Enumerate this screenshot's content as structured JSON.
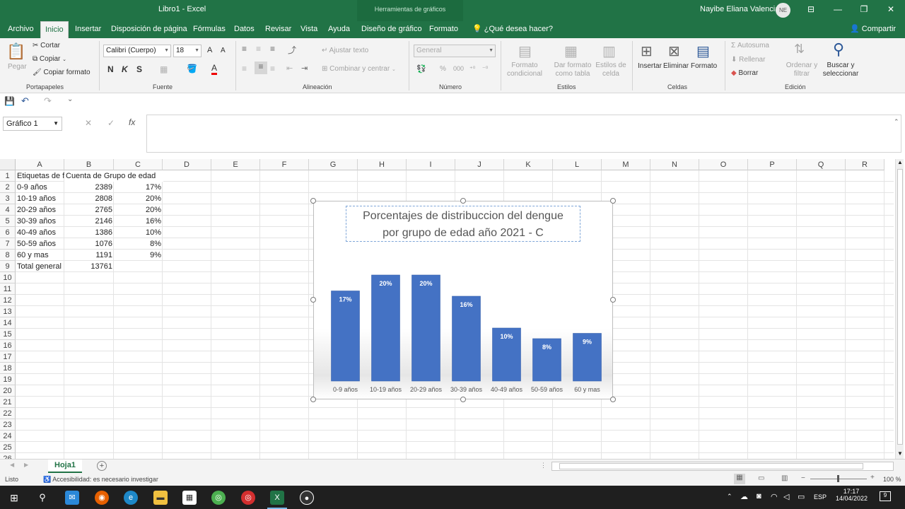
{
  "window": {
    "title": "Libro1  -  Excel",
    "contextual_tab": "Herramientas de gráficos",
    "user_name": "Nayibe Eliana Valencia",
    "user_initials": "NE",
    "minimize": "—",
    "restore": "❐",
    "close": "✕",
    "ribbon_display": "⊟"
  },
  "tabs": [
    "Archivo",
    "Inicio",
    "Insertar",
    "Disposición de página",
    "Fórmulas",
    "Datos",
    "Revisar",
    "Vista",
    "Ayuda",
    "Diseño de gráfico",
    "Formato"
  ],
  "tell_me": "¿Qué desea hacer?",
  "share": "Compartir",
  "ribbon": {
    "clipboard": {
      "paste": "Pegar",
      "cut": "Cortar",
      "copy": "Copiar",
      "format_painter": "Copiar formato",
      "label": "Portapapeles"
    },
    "font": {
      "family": "Calibri (Cuerpo)",
      "size": "18",
      "bold": "N",
      "italic": "K",
      "underline": "S",
      "label": "Fuente",
      "grow": "A",
      "shrink": "A",
      "color_letter": "A"
    },
    "alignment": {
      "wrap": "Ajustar texto",
      "merge": "Combinar y centrar",
      "label": "Alineación"
    },
    "number": {
      "format": "General",
      "label": "Número",
      "percent": "%",
      "thousands": "000"
    },
    "styles": {
      "conditional": "Formato condicional",
      "table": "Dar formato como tabla",
      "cell_styles": "Estilos de celda",
      "label": "Estilos"
    },
    "cells": {
      "insert": "Insertar",
      "delete": "Eliminar",
      "format": "Formato",
      "label": "Celdas"
    },
    "editing": {
      "autosum": "Autosuma",
      "fill": "Rellenar",
      "clear": "Borrar",
      "sort": "Ordenar y filtrar",
      "find": "Buscar y seleccionar",
      "label": "Edición"
    }
  },
  "formula_bar": {
    "name_box": "Gráfico 1",
    "fx": "fx",
    "cancel": "✕",
    "enter": "✓",
    "content": ""
  },
  "columns": [
    "A",
    "B",
    "C",
    "D",
    "E",
    "F",
    "G",
    "H",
    "I",
    "J",
    "K",
    "L",
    "M",
    "N",
    "O",
    "P",
    "Q",
    "R"
  ],
  "rows": [
    "1",
    "2",
    "3",
    "4",
    "5",
    "6",
    "7",
    "8",
    "9",
    "10",
    "11",
    "12",
    "13",
    "14",
    "15",
    "16",
    "17",
    "18",
    "19",
    "20",
    "21",
    "22",
    "23",
    "24",
    "25",
    "26"
  ],
  "cells": {
    "header": [
      "Etiquetas de f",
      "Cuenta de Grupo de edad",
      ""
    ],
    "data": [
      [
        "0-9 años",
        "2389",
        "17%"
      ],
      [
        "10-19 años",
        "2808",
        "20%"
      ],
      [
        "20-29 años",
        "2765",
        "20%"
      ],
      [
        "30-39 años",
        "2146",
        "16%"
      ],
      [
        "40-49 años",
        "1386",
        "10%"
      ],
      [
        "50-59 años",
        "1076",
        "8%"
      ],
      [
        "60 y mas",
        "1191",
        "9%"
      ]
    ],
    "total": [
      "Total general",
      "13761",
      ""
    ]
  },
  "chart_data": {
    "type": "bar",
    "title": "Porcentajes de distribuccion del dengue por grupo de edad año 2021 - C",
    "title_lines": [
      "Porcentajes de distribuccion del dengue",
      "por grupo de edad año 2021 - C"
    ],
    "categories": [
      "0-9 años",
      "10-19 años",
      "20-29 años",
      "30-39 años",
      "40-49 años",
      "50-59 años",
      "60 y mas"
    ],
    "values": [
      17,
      20,
      20,
      16,
      10,
      8,
      9
    ],
    "labels": [
      "17%",
      "20%",
      "20%",
      "16%",
      "10%",
      "8%",
      "9%"
    ],
    "xlabel": "",
    "ylabel": "",
    "ylim": [
      0,
      20
    ],
    "bar_color": "#4472c4",
    "grid": false,
    "legend": "none"
  },
  "sheets": {
    "active": "Hoja1",
    "add": "+"
  },
  "status": {
    "ready": "Listo",
    "accessibility": "Accesibilidad: es necesario investigar",
    "zoom": "100 %"
  },
  "taskbar": {
    "time": "17:17",
    "date": "14/04/2022",
    "lang": "ESP",
    "notifications": "9"
  }
}
